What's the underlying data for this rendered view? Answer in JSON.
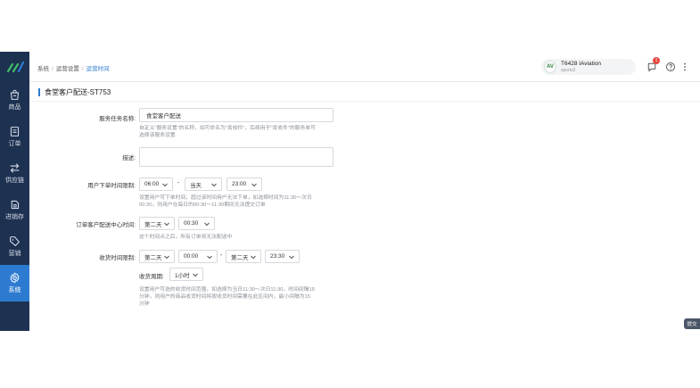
{
  "nav": {
    "items": [
      {
        "label": "商品",
        "icon": "shopping-bag-icon"
      },
      {
        "label": "订单",
        "icon": "order-document-icon"
      },
      {
        "label": "供应链",
        "icon": "supply-chain-arrows-icon"
      },
      {
        "label": "进销存",
        "icon": "inventory-icon"
      },
      {
        "label": "营销",
        "icon": "tag-icon"
      },
      {
        "label": "系统",
        "icon": "gear-icon",
        "active": true
      }
    ]
  },
  "breadcrumb": {
    "items": [
      "系统",
      "运营设置",
      "运营时间"
    ]
  },
  "account": {
    "logo_text": "AV",
    "name": "T6428 IAviation",
    "sub": "sports2"
  },
  "notifications": {
    "count": "1"
  },
  "page": {
    "title": "食堂客户配送-ST753"
  },
  "form": {
    "task_name": {
      "label": "服务任务名称:",
      "value": "食堂客户配送",
      "hint1": "自定义\"服务设置\"的名称，如可命名为\"肯收件\"，后续用于\"肯收件\"的服务单可",
      "hint2": "选择该服务设置"
    },
    "description": {
      "label": "描述:"
    },
    "order_cutoff": {
      "label": "用户下单时间限制:",
      "start_time": "06:00",
      "end_day": "当天",
      "end_time": "23:00",
      "hint1": "设置用户可下单时间，超过该时间用户无法下单，如选择时间为11:30～次日",
      "hint2": "00:30，则用户在每日的00:30～11:30期间无法提交订单"
    },
    "delivery_start": {
      "label": "订单客户配送中心时间:",
      "day": "第二天",
      "time": "00:30",
      "hint": "这个时间点之后，所有订单将无法配送中"
    },
    "receive_window": {
      "label": "收货时间限制:",
      "start_day": "第二天",
      "start_time": "00:00",
      "end_day": "第二天",
      "end_time": "23:30",
      "cycle_label": "收货周期:",
      "cycle_value": "1小时",
      "hint1": "设置用户可选的收货时间范围，如选择为当日11:30～次日11:30，时间间隔15",
      "hint2": "分钟，则用户的商品收货时间将按收货时间需要在此区间内，最小间隔为15",
      "hint3": "分钟"
    }
  },
  "float_button": {
    "label": "提交"
  }
}
